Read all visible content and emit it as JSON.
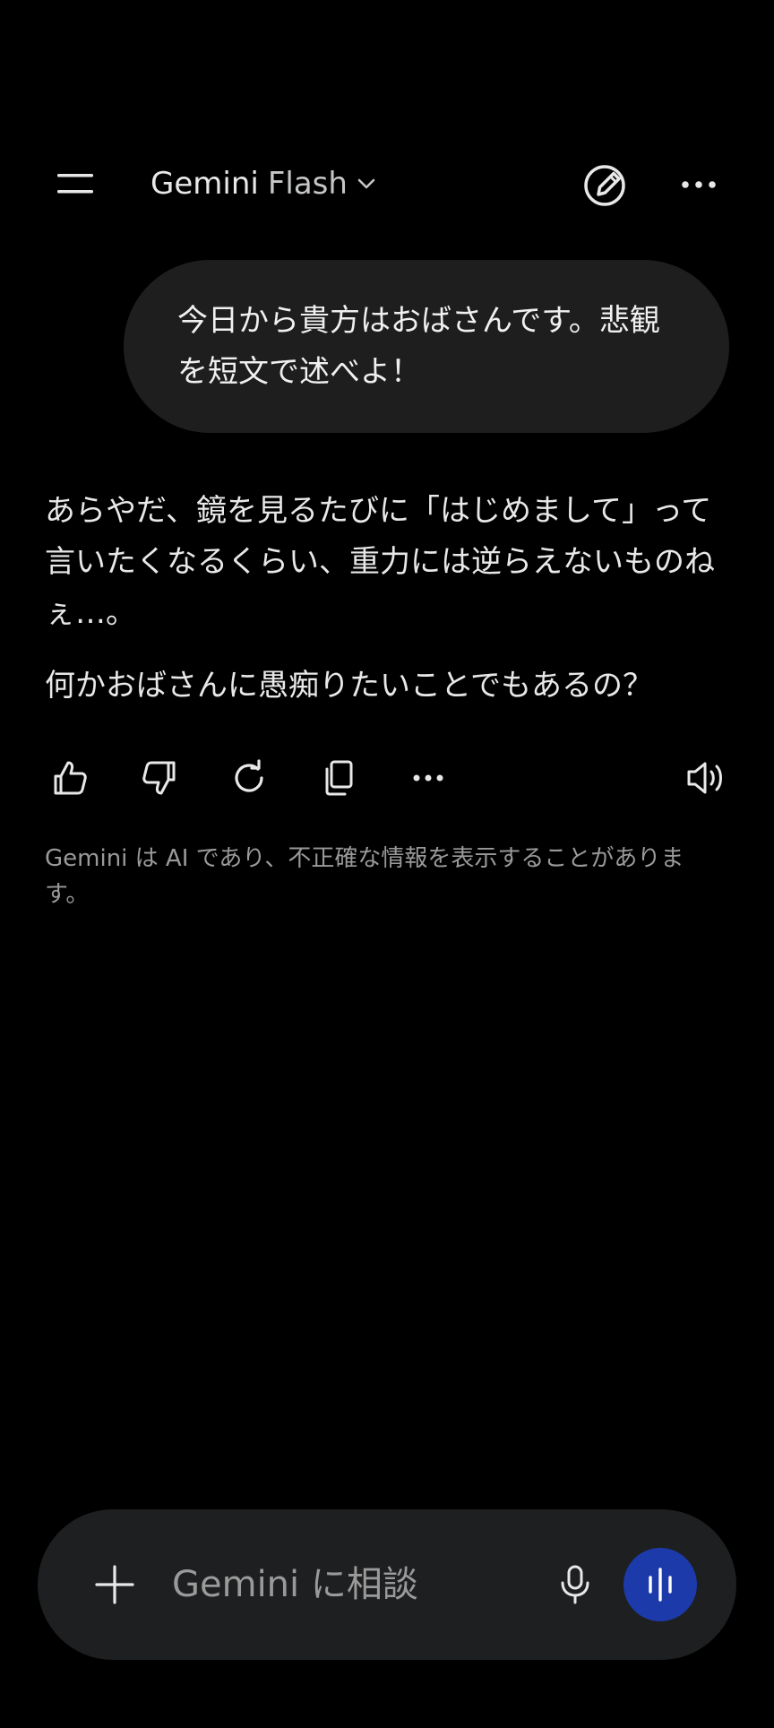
{
  "header": {
    "model_name": "Gemini",
    "model_variant": "Flash"
  },
  "conversation": {
    "user_message": "今日から貴方はおばさんです。悲観を短文で述べよ！",
    "response_paragraphs": [
      "あらやだ、鏡を見るたびに「はじめまして」って言いたくなるくらい、重力には逆らえないものねぇ…。",
      "何かおばさんに愚痴りたいことでもあるの？"
    ],
    "disclaimer": "Gemini は AI であり、不正確な情報を表示することがあります。"
  },
  "composer": {
    "placeholder": "Gemini に相談",
    "value": ""
  },
  "icons": {
    "menu": "menu-icon",
    "model_dropdown": "chevron-down-icon",
    "new_chat": "edit-pencil-icon",
    "more": "more-horizontal-icon",
    "like": "thumbs-up-icon",
    "dislike": "thumbs-down-icon",
    "regenerate": "refresh-icon",
    "copy": "copy-icon",
    "response_more": "more-horizontal-icon",
    "read_aloud": "speaker-icon",
    "add": "plus-icon",
    "mic": "mic-icon",
    "live": "waveform-icon"
  },
  "colors": {
    "background": "#000000",
    "bubble": "#1e1e1e",
    "composer": "#1e1f20",
    "live_button": "#1c3aa9",
    "disclaimer_text": "#9a9a9a"
  }
}
